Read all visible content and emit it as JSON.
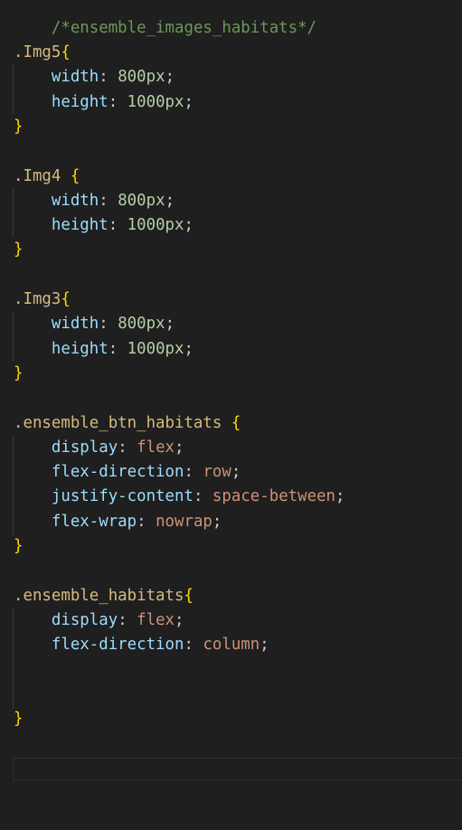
{
  "editor": {
    "comment": "/*ensemble_images_habitats*/",
    "blocks": [
      {
        "selector": ".Img5",
        "open": "{",
        "decls": [
          {
            "prop": "width",
            "value": "800px"
          },
          {
            "prop": "height",
            "value": "1000px"
          }
        ],
        "close": "}"
      },
      {
        "selector": ".Img4 ",
        "open": "{",
        "decls": [
          {
            "prop": "width",
            "value": "800px"
          },
          {
            "prop": "height",
            "value": "1000px"
          }
        ],
        "close": "}"
      },
      {
        "selector": ".Img3",
        "open": "{",
        "decls": [
          {
            "prop": "width",
            "value": "800px"
          },
          {
            "prop": "height",
            "value": "1000px"
          }
        ],
        "close": "}"
      },
      {
        "selector": ".ensemble_btn_habitats ",
        "open": "{",
        "decls": [
          {
            "prop": "display",
            "value": "flex"
          },
          {
            "prop": "flex-direction",
            "value": "row"
          },
          {
            "prop": "justify-content",
            "value": "space-between"
          },
          {
            "prop": "flex-wrap",
            "value": "nowrap"
          }
        ],
        "close": "}"
      },
      {
        "selector": ".ensemble_habitats",
        "open": "{",
        "decls": [
          {
            "prop": "display",
            "value": "flex"
          },
          {
            "prop": "flex-direction",
            "value": "column"
          }
        ],
        "close": "}"
      }
    ],
    "colon": ": ",
    "semicolon": ";"
  }
}
